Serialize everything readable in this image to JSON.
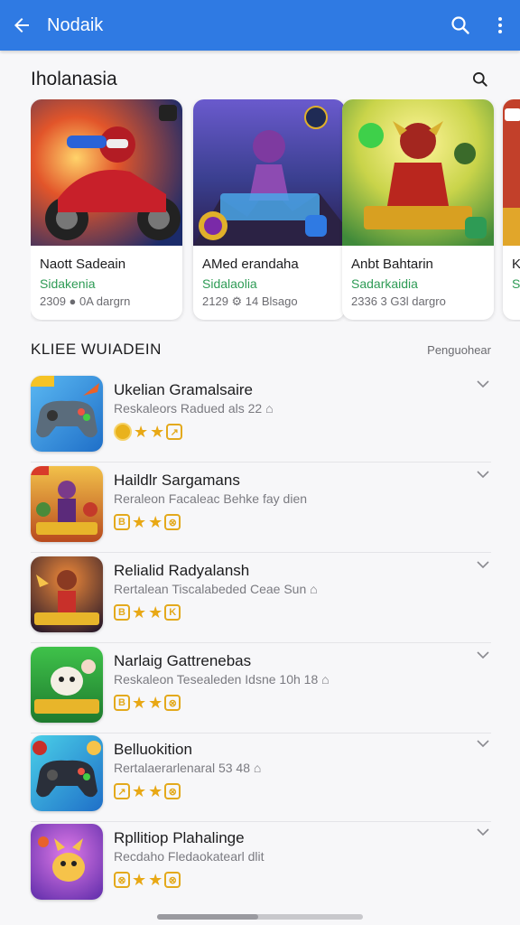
{
  "app_bar": {
    "title": "Nodaik"
  },
  "featured": {
    "heading": "Iholanasia",
    "cards": [
      {
        "title": "Naott Sadeain",
        "developer": "Sidakenia",
        "meta": "2309 ● 0A dargrn"
      },
      {
        "title": "AMed erandaha",
        "developer": "Sidalaolia",
        "meta": "2129 ⚙ 14 Blsago"
      },
      {
        "title": "Anbt Bahtarin",
        "developer": "Sadarkaidia",
        "meta": "2336 3 G3l dargro"
      },
      {
        "title": "Ks",
        "developer": "Sa",
        "meta": ""
      }
    ]
  },
  "list": {
    "heading": "KLIEE WUIADEIN",
    "side_label": "Penguohear",
    "items": [
      {
        "name": "Ukelian Gramalsaire",
        "subtitle": "Reskaleors Radued als  22  ⌂"
      },
      {
        "name": "Haildlr Sargamans",
        "subtitle": "Reraleon Facaleac Behke fay dien"
      },
      {
        "name": "Relialid Radyalansh",
        "subtitle": "Rertalean Tiscalabeded Ceae Sun ⌂"
      },
      {
        "name": "Narlaig Gattrenebas",
        "subtitle": "Reskaleon Tesealeden Idsne 10h  18  ⌂"
      },
      {
        "name": "Belluokition",
        "subtitle": "Rertalaerarlenaral 53  48  ⌂"
      },
      {
        "name": "Rpllitiop Plahalinge",
        "subtitle": "Recdaho Fledaokatearl dlit"
      }
    ]
  },
  "colors": {
    "app_bar": "#2f7ae3",
    "developer_green": "#2e9b55",
    "star": "#e8a815"
  },
  "icons": {
    "back": "arrow-left-icon",
    "search": "search-icon",
    "more": "more-vert-icon",
    "chevron": "chevron-down-icon"
  }
}
